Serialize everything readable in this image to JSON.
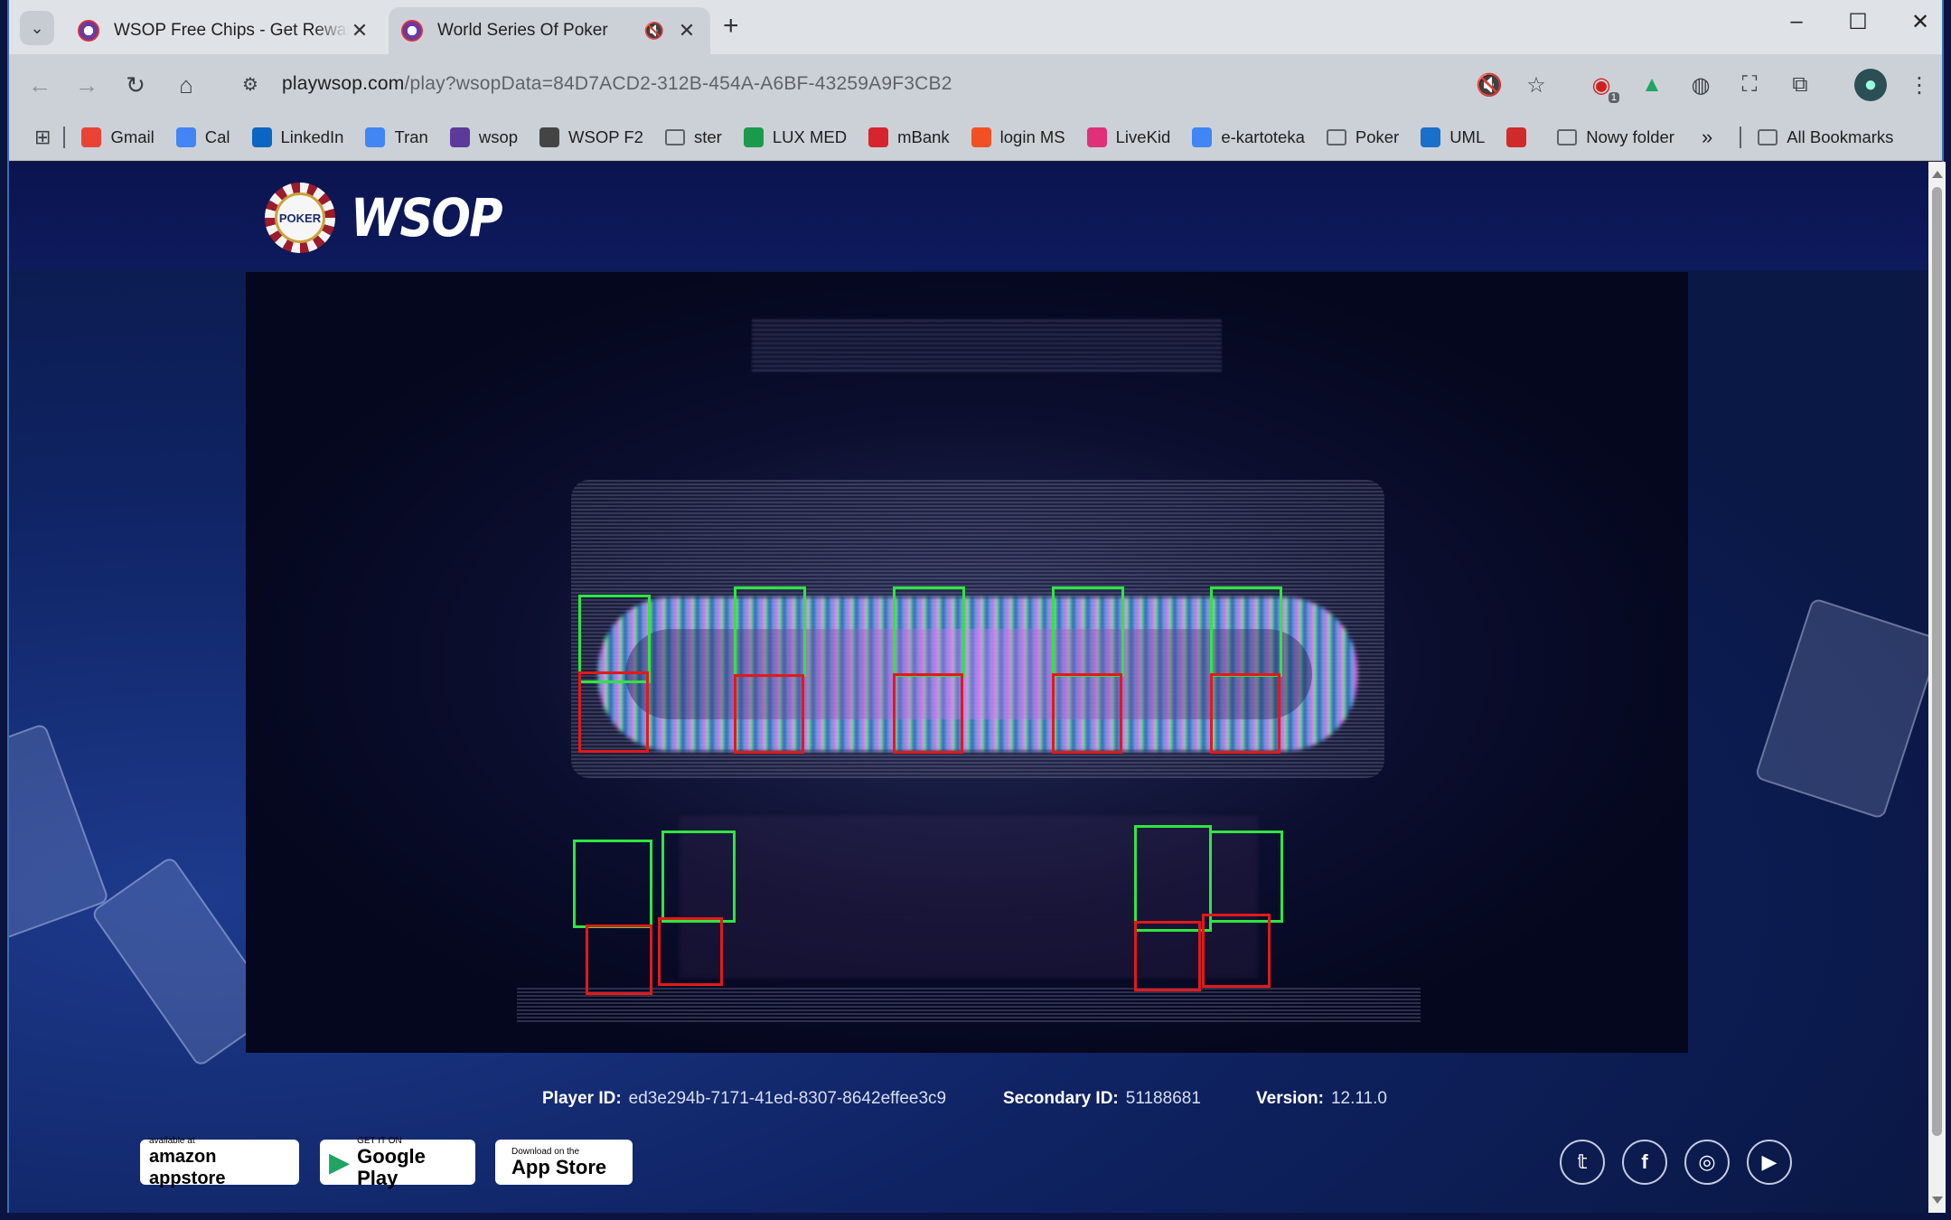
{
  "browser": {
    "tabs": [
      {
        "title": "WSOP Free Chips - Get Rewards",
        "active": false
      },
      {
        "title": "World Series Of Poker",
        "active": true
      }
    ],
    "url_host": "playwsop.com",
    "url_rest": "/play?wsopData=84D7ACD2-312B-454A-A6BF-43259A9F3CB2",
    "extension_badge": "1",
    "bookmarks": [
      {
        "label": "Gmail",
        "icon": "gmail-icon",
        "color": "#ea4335"
      },
      {
        "label": "Cal",
        "icon": "calendar-icon",
        "color": "#4285f4"
      },
      {
        "label": "LinkedIn",
        "icon": "linkedin-icon",
        "color": "#0a66c2"
      },
      {
        "label": "Tran",
        "icon": "translate-icon",
        "color": "#4285f4"
      },
      {
        "label": "wsop",
        "icon": "wsop-icon",
        "color": "#5b3a9a"
      },
      {
        "label": "WSOP F2",
        "icon": "gear-icon",
        "color": "#444444"
      },
      {
        "label": "ster",
        "icon": "folder-icon",
        "color": ""
      },
      {
        "label": "LUX MED",
        "icon": "luxmed-icon",
        "color": "#1a9a4a"
      },
      {
        "label": "mBank",
        "icon": "mbank-icon",
        "color": "#d6252d"
      },
      {
        "label": "login MS",
        "icon": "microsoft-icon",
        "color": "#f25022"
      },
      {
        "label": "LiveKid",
        "icon": "livekid-icon",
        "color": "#e0307a"
      },
      {
        "label": "e-kartoteka",
        "icon": "google-icon",
        "color": "#4285f4"
      },
      {
        "label": "Poker",
        "icon": "folder-icon",
        "color": ""
      },
      {
        "label": "UML",
        "icon": "uml-icon",
        "color": "#1a6fc9"
      },
      {
        "label": "",
        "icon": "lips-icon",
        "color": "#d02a2a"
      },
      {
        "label": "Nowy folder",
        "icon": "folder-icon",
        "color": ""
      }
    ],
    "all_bookmarks": "All Bookmarks"
  },
  "site": {
    "logo_chip": "POKER",
    "logo_text": "WSOP"
  },
  "footer": {
    "player_id_label": "Player ID:",
    "player_id": "ed3e294b-7171-41ed-8307-8642effee3c9",
    "secondary_id_label": "Secondary ID:",
    "secondary_id": "51188681",
    "version_label": "Version:",
    "version": "12.11.0",
    "stores": [
      {
        "small": "available at",
        "big": "amazon appstore"
      },
      {
        "small": "GET IT ON",
        "big": "Google Play"
      },
      {
        "small": "Download on the",
        "big": "App Store"
      }
    ],
    "social": [
      "twitter-icon",
      "facebook-icon",
      "instagram-icon",
      "youtube-icon"
    ]
  },
  "colors": {
    "accent": "#0d1a5c",
    "seat_green": "#2ee640",
    "seat_red": "#e01a1a"
  }
}
